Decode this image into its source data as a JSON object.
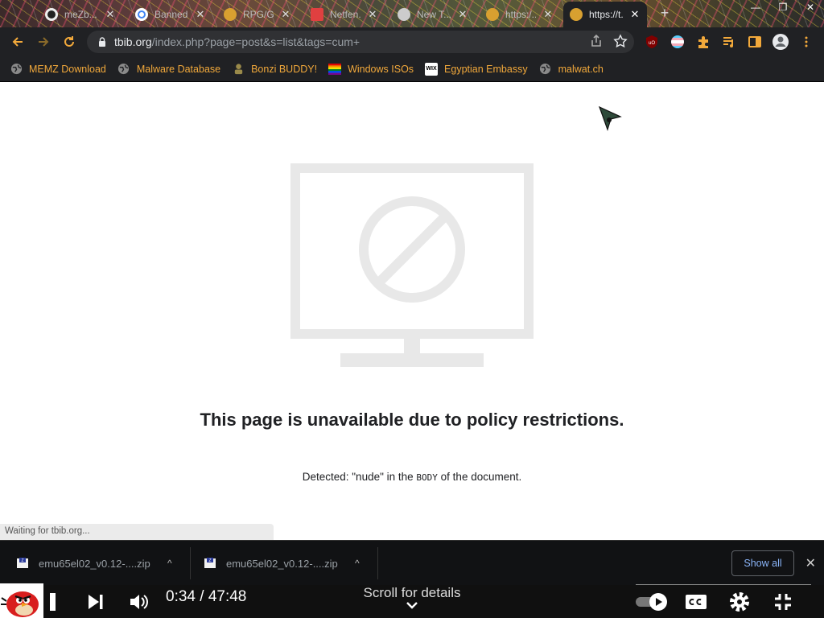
{
  "tabs": [
    {
      "label": "meZb...",
      "close": "✕"
    },
    {
      "label": "Banned...",
      "close": "✕"
    },
    {
      "label": "RPG/Ge...",
      "close": "✕"
    },
    {
      "label": "Netfen...",
      "close": "✕"
    },
    {
      "label": "New T...",
      "close": "✕"
    },
    {
      "label": "https:/...",
      "close": "✕"
    },
    {
      "label": "https://t...",
      "close": "✕"
    }
  ],
  "newtab": "+",
  "window": {
    "minimize": "—",
    "restore": "❐",
    "close": "✕"
  },
  "address": {
    "host": "tbib.org",
    "path": "/index.php?page=post&s=list&tags=cum+"
  },
  "extensions": {
    "ublock_label": "uO"
  },
  "bookmarks": [
    {
      "label": "MEMZ Download"
    },
    {
      "label": "Malware Database"
    },
    {
      "label": "Bonzi BUDDY!"
    },
    {
      "label": "Windows ISOs"
    },
    {
      "label": "Egyptian Embassy"
    },
    {
      "label": "malwat.ch"
    }
  ],
  "wix_label": "WIX",
  "page": {
    "heading": "This page is unavailable due to policy restrictions.",
    "detail_pre": "Detected: \"nude\" in the ",
    "detail_code": "BODY",
    "detail_post": " of the document."
  },
  "status": "Waiting for tbib.org...",
  "downloads": {
    "items": [
      {
        "name": "emu65el02_v0.12-....zip"
      },
      {
        "name": "emu65el02_v0.12-....zip"
      }
    ],
    "show_all": "Show all",
    "close": "✕"
  },
  "player": {
    "current_time": "0:34",
    "separator": " / ",
    "duration": "47:48",
    "scroll_hint": "Scroll for details"
  },
  "colors": {
    "toolbar": "#202124",
    "bookmark_text": "#f2a93b",
    "placeholder_gray": "#e8e8e8",
    "link_blue": "#8ab4f8"
  }
}
